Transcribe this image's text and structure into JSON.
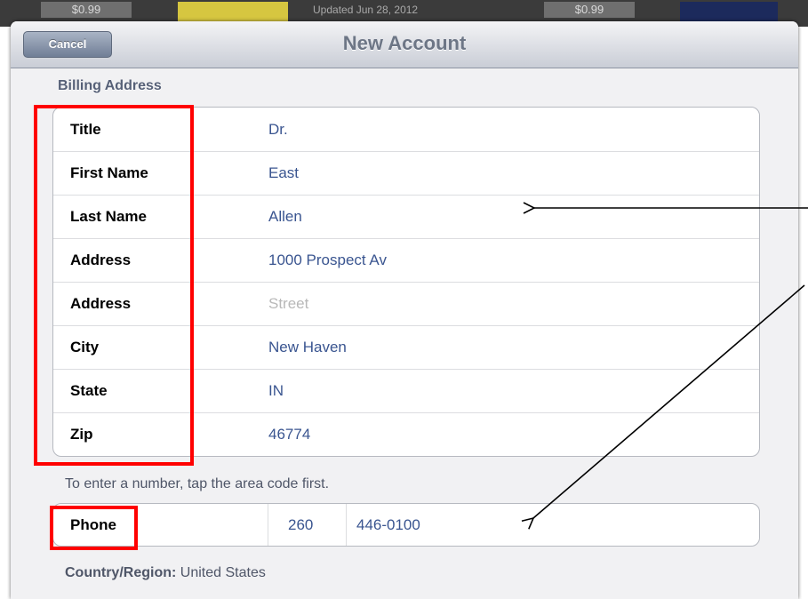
{
  "background": {
    "price_left": "$0.99",
    "updated_text": "Updated Jun 28, 2012",
    "price_right": "$0.99"
  },
  "navbar": {
    "cancel_label": "Cancel",
    "title": "New Account"
  },
  "billing": {
    "header": "Billing Address",
    "rows": [
      {
        "label": "Title",
        "value": "Dr."
      },
      {
        "label": "First Name",
        "value": "East"
      },
      {
        "label": "Last Name",
        "value": "Allen"
      },
      {
        "label": "Address",
        "value": "1000 Prospect Av"
      },
      {
        "label": "Address",
        "placeholder": "Street"
      },
      {
        "label": "City",
        "value": "New Haven"
      },
      {
        "label": "State",
        "value": "IN"
      },
      {
        "label": "Zip",
        "value": "46774"
      }
    ]
  },
  "phone": {
    "instruction": "To enter a number, tap the area code first.",
    "label": "Phone",
    "area_code": "260",
    "number": "446-0100"
  },
  "country": {
    "label": "Country/Region:",
    "value": "United States"
  },
  "colors": {
    "annotation": "#ff0000",
    "value_text": "#3a5590",
    "header_text": "#566077"
  }
}
